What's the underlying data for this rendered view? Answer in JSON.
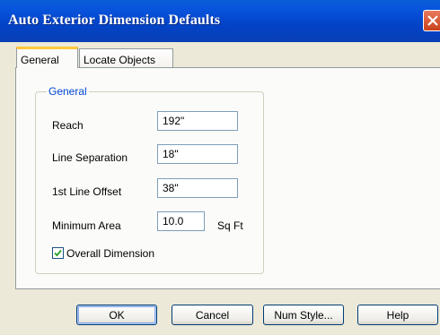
{
  "window": {
    "title": "Auto Exterior Dimension Defaults"
  },
  "tabs": [
    {
      "label": "General"
    },
    {
      "label": "Locate Objects"
    }
  ],
  "general": {
    "group_title": "General",
    "fields": [
      {
        "label": "Reach",
        "value": "192\""
      },
      {
        "label": "Line Separation",
        "value": "18\""
      },
      {
        "label": "1st Line Offset",
        "value": "38\""
      },
      {
        "label": "Minimum Area",
        "value": "10.0",
        "unit": "Sq Ft"
      }
    ],
    "overall_dimension": {
      "label": "Overall Dimension",
      "checked": true
    }
  },
  "buttons": {
    "ok": "OK",
    "cancel": "Cancel",
    "num_style": "Num Style...",
    "help": "Help"
  },
  "colors": {
    "titlebar": "#0855dd",
    "group_title": "#0046d5",
    "tab_highlight": "#ffc73c",
    "close": "#c9401c"
  },
  "icons": {
    "close": "close-icon",
    "check": "checkmark-icon"
  }
}
